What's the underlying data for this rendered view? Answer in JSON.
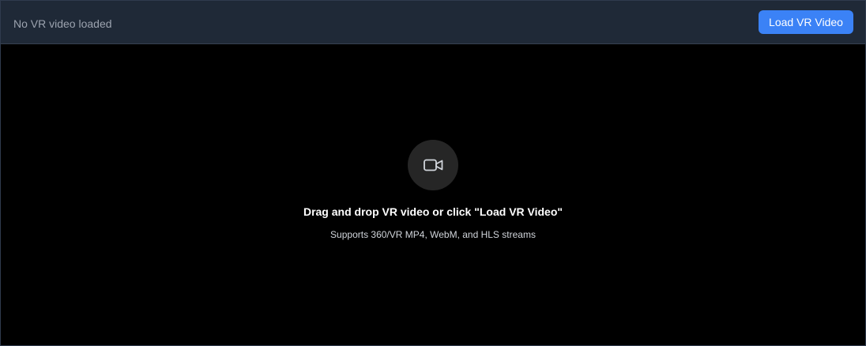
{
  "header": {
    "status_text": "No VR video loaded",
    "load_button_label": "Load VR Video"
  },
  "dropzone": {
    "icon": "video-camera-icon",
    "headline": "Drag and drop VR video or click \"Load VR Video\"",
    "subline": "Supports 360/VR MP4, WebM, and HLS streams"
  },
  "colors": {
    "header_bg": "#1f2937",
    "accent": "#3b82f6",
    "stage_bg": "#000000"
  }
}
